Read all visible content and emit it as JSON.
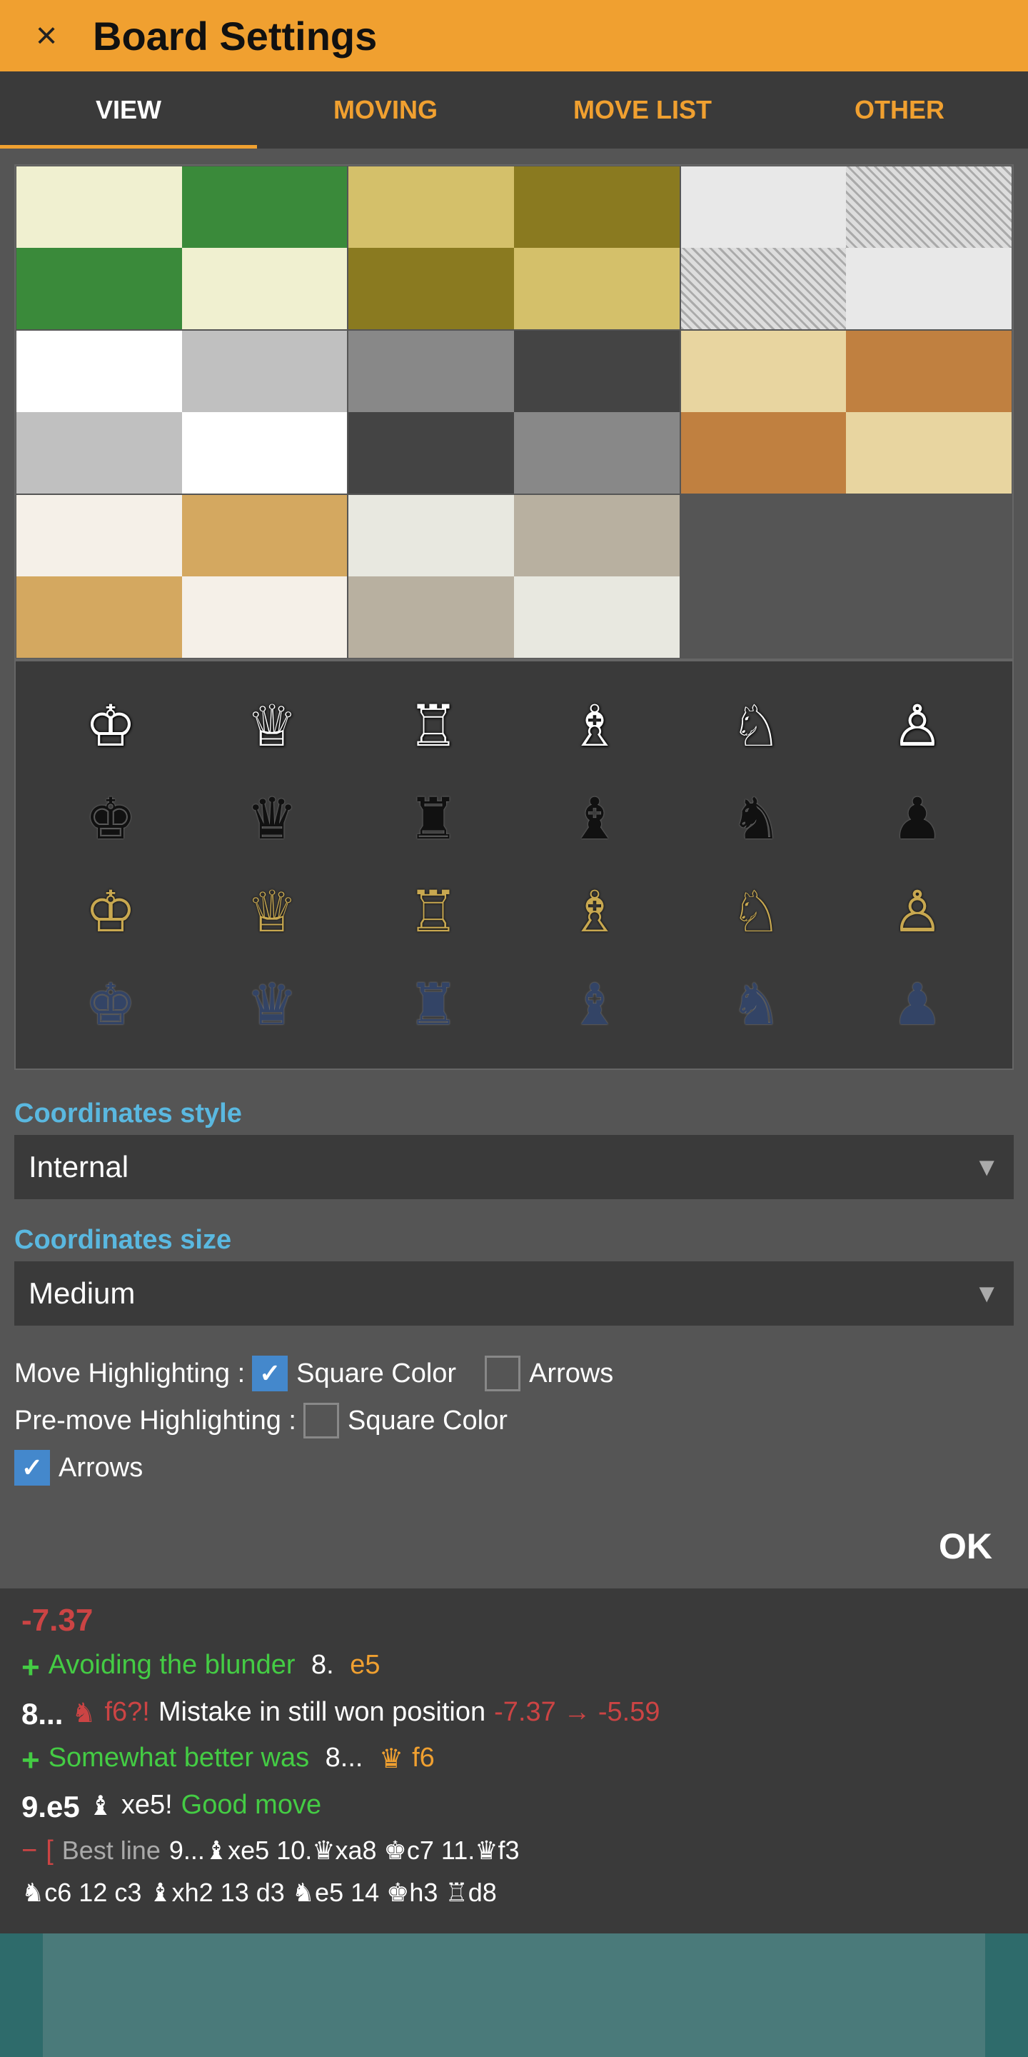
{
  "header": {
    "title": "Board Settings",
    "close_label": "×"
  },
  "tabs": [
    {
      "id": "view",
      "label": "VIEW",
      "active": true
    },
    {
      "id": "moving",
      "label": "MOVING",
      "active": false
    },
    {
      "id": "move_list",
      "label": "MOVE LIST",
      "active": false
    },
    {
      "id": "other",
      "label": "OTHER",
      "active": false
    }
  ],
  "board_themes": {
    "rows": [
      [
        "green",
        "gold",
        "hatched"
      ],
      [
        "whitegrey",
        "darkgrey",
        "leather"
      ],
      [
        "lightwood",
        "marble",
        ""
      ]
    ]
  },
  "pieces": {
    "white_row": [
      "♔",
      "♕",
      "♖",
      "♗",
      "♘",
      "♙"
    ],
    "black_row": [
      "♚",
      "♛",
      "♜",
      "♝",
      "♞",
      "♟"
    ],
    "tan_row": [
      "♔",
      "♕",
      "♖",
      "♗",
      "♘",
      "♙"
    ],
    "navy_row": [
      "♚",
      "♛",
      "♜",
      "♝",
      "♞",
      "♟"
    ]
  },
  "settings": {
    "coordinates_style_label": "Coordinates style",
    "coordinates_style_value": "Internal",
    "coordinates_size_label": "Coordinates size",
    "coordinates_size_value": "Medium",
    "move_highlighting_label": "Move Highlighting :",
    "square_color_label": "Square Color",
    "arrows_label": "Arrows",
    "premove_highlighting_label": "Pre-move Highlighting :",
    "premove_square_color_label": "Square Color",
    "premove_arrows_label": "Arrows",
    "move_highlighting_square_checked": true,
    "move_highlighting_arrows_checked": false,
    "premove_square_checked": false,
    "premove_arrows_checked": true
  },
  "ok_button": "OK",
  "analysis": {
    "score": "-7.37",
    "lines": [
      {
        "type": "plus",
        "text": "Avoiding the blunder",
        "move": "8.",
        "move2": "e5",
        "move2_color": "orange"
      },
      {
        "prefix": "8...",
        "piece_icon": "♞",
        "move": "f6?!",
        "label": "Mistake in still won position",
        "score_arrow": "-7.37 → -5.59"
      },
      {
        "type": "plus",
        "text": "Somewhat better was",
        "move": "8...",
        "piece_icon2": "♛",
        "move2": "f6"
      }
    ],
    "good_move_line": "9.e5",
    "good_move_piece": "♝",
    "good_move_text": "xe5!",
    "good_move_label": "Good move",
    "best_line_label": "Best line",
    "best_line_moves": "9...♝xe5  10.♛xa8  ♚c7  11.♛f3"
  },
  "bottom_line": "♞c6  12 c3  ♝xh2  13 d3  ♞e5  14 ♚h3  ♖d8"
}
